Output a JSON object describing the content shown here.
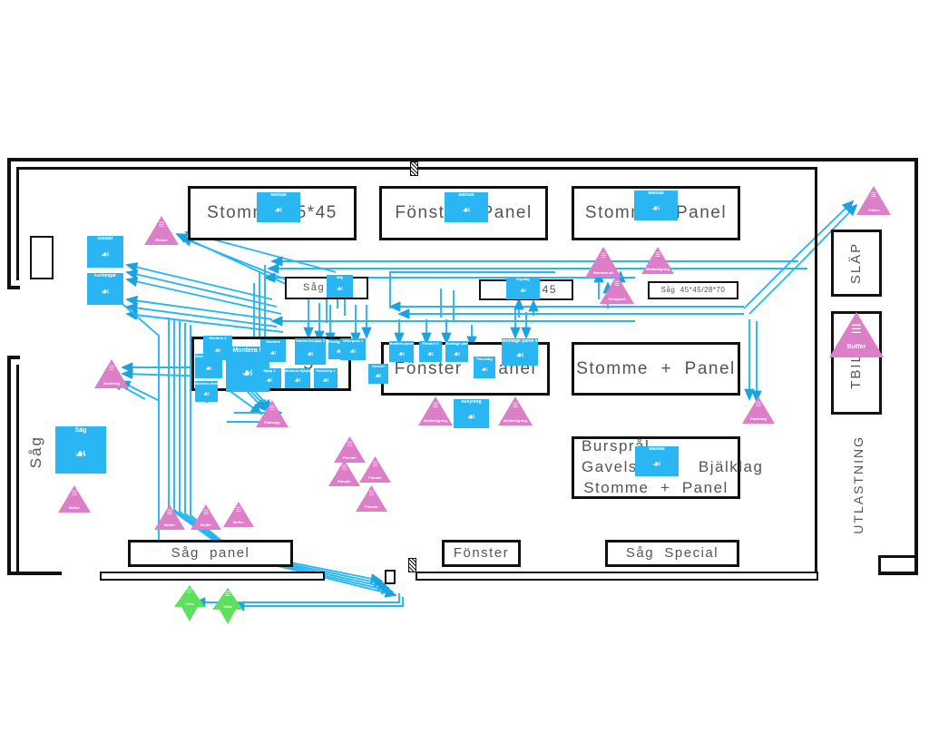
{
  "diagram": {
    "title": "Factory layout value stream map",
    "colors": {
      "process_fill": "#29b6f2",
      "inventory_fill": "#dd7ec8",
      "material_fill": "#5de05d",
      "flow_line": "#29b6f2",
      "wall": "#111111",
      "label_text": "#555555"
    }
  },
  "areas": [
    {
      "name": "stomme-45x45-area",
      "label": "Stomme 45*45"
    },
    {
      "name": "fonster-panel-area",
      "label": "Fönster   Panel"
    },
    {
      "name": "stomme-panel-area",
      "label": "Stomme   Panel"
    },
    {
      "name": "sag-cell-area",
      "label": "Såg"
    },
    {
      "name": "sag-45-area",
      "label": "45"
    },
    {
      "name": "sag-dim-area",
      "label": "Såg  45*45/28*70"
    },
    {
      "name": "montera-area",
      "label": "4          5"
    },
    {
      "name": "fonster-panel-cell",
      "label": "Fönster  +  anel"
    },
    {
      "name": "stomme-panel-cell",
      "label": "Stomme  +  Panel"
    },
    {
      "name": "bjalklag-area",
      "line1": "Bursprål",
      "line2": "Gavelsp         Bjälklag",
      "line3": "Stomme  +  Panel"
    },
    {
      "name": "sag-panel-area",
      "label": "Såg  panel"
    },
    {
      "name": "fonster-area",
      "label": "Fönster"
    },
    {
      "name": "sag-special-area",
      "label": "Såg  Special"
    },
    {
      "name": "slap-area",
      "label": "SLÄP"
    },
    {
      "name": "tbil-area",
      "label": "TBIL"
    },
    {
      "name": "utlastning-label",
      "label": "UTLASTNING"
    },
    {
      "name": "sag-hall-label",
      "label": "Såg"
    }
  ],
  "operations": [
    {
      "name": "op-manual-stomme45",
      "label": "Manual",
      "icon": "worker-icon"
    },
    {
      "name": "op-manual-fonster",
      "label": "Manual",
      "icon": "worker-icon"
    },
    {
      "name": "op-manual-stommepanel",
      "label": "Manual",
      "icon": "worker-icon"
    },
    {
      "name": "op-manual-bjalklag",
      "label": "Manual",
      "icon": "worker-icon"
    },
    {
      "name": "op-stolpar",
      "label": "Stolpar",
      "icon": "worker-icon"
    },
    {
      "name": "op-kortlingar",
      "label": "Kortlingar",
      "icon": "worker-icon"
    },
    {
      "name": "op-sag",
      "label": "Såg",
      "icon": "worker-icon"
    },
    {
      "name": "op-kapsag",
      "label": "Kapsåg",
      "icon": "worker-icon"
    },
    {
      "name": "op-montera-1",
      "label": "Montera stom 1",
      "icon": "worker-icon"
    },
    {
      "name": "op-montera-2",
      "label": "Montera stom 2",
      "icon": "worker-icon"
    },
    {
      "name": "op-montera-3",
      "label": "Montera 3",
      "icon": "worker-icon"
    },
    {
      "name": "op-montera-5",
      "label": "Montera 5",
      "icon": "worker-icon"
    },
    {
      "name": "op-montera-4",
      "label": "Montera",
      "icon": "worker-icon"
    },
    {
      "name": "op-hantverkshjalp",
      "label": "Hantverkshjälp 3",
      "icon": "worker-icon"
    },
    {
      "name": "op-fardigmontering",
      "label": "Färdigmontering",
      "icon": "worker-icon"
    },
    {
      "name": "op-hjalp-2",
      "label": "Hjälp 2",
      "icon": "worker-icon"
    },
    {
      "name": "op-montera-hjalp-5",
      "label": "Montera hjälpa 5",
      "icon": "worker-icon"
    },
    {
      "name": "op-packning-1",
      "label": "Packning 1",
      "icon": "worker-icon"
    },
    {
      "name": "op-vaterpack-1",
      "label": "Väterpack 1",
      "icon": "worker-icon"
    },
    {
      "name": "op-vanster",
      "label": "Vänster",
      "icon": "worker-icon"
    },
    {
      "name": "op-montera-panel-1",
      "label": "Montera panel",
      "icon": "worker-icon"
    },
    {
      "name": "op-fonster-1",
      "label": "Fönster 1",
      "icon": "worker-icon"
    },
    {
      "name": "op-montage-1",
      "label": "Montage panel 1",
      "icon": "worker-icon"
    },
    {
      "name": "op-montage-panel-4",
      "label": "Montage panel 4",
      "icon": "worker-icon"
    },
    {
      "name": "op-panelsag",
      "label": "Panelsåg",
      "icon": "worker-icon"
    },
    {
      "name": "op-avsyning",
      "label": "Avsyning",
      "icon": "worker-icon"
    },
    {
      "name": "op-sag-hall",
      "label": "Såg",
      "icon": "worker-icon"
    }
  ],
  "inventories": [
    {
      "name": "tri-riktare",
      "label": "Riktare",
      "icon": "inventory-icon"
    },
    {
      "name": "tri-sortering",
      "label": "Sortering",
      "icon": "inventory-icon"
    },
    {
      "name": "tri-flakkapp",
      "label": "Flakkapp",
      "icon": "inventory-icon"
    },
    {
      "name": "tri-buffer-left",
      "label": "Buffer",
      "icon": "inventory-icon"
    },
    {
      "name": "tri-mellanlagring-1",
      "label": "Mellanlagring",
      "icon": "inventory-icon"
    },
    {
      "name": "tri-mellanlagring-2",
      "label": "Mellanlagring",
      "icon": "inventory-icon"
    },
    {
      "name": "tri-gleopanel",
      "label": "Gleopanel",
      "icon": "inventory-icon"
    },
    {
      "name": "tri-montera-stt",
      "label": "Montera stt",
      "icon": "inventory-icon"
    },
    {
      "name": "tri-mellanlagring-3",
      "label": "Mellanlagring",
      "icon": "inventory-icon"
    },
    {
      "name": "tri-fonster-1",
      "label": "Fönster",
      "icon": "inventory-icon"
    },
    {
      "name": "tri-fonster-2",
      "label": "Fönster",
      "icon": "inventory-icon"
    },
    {
      "name": "tri-fonster-3",
      "label": "Fönster",
      "icon": "inventory-icon"
    },
    {
      "name": "tri-fonster-4",
      "label": "Fönster",
      "icon": "inventory-icon"
    },
    {
      "name": "tri-buffer-b1",
      "label": "Buffer",
      "icon": "inventory-icon"
    },
    {
      "name": "tri-buffer-b2",
      "label": "Buffer",
      "icon": "inventory-icon"
    },
    {
      "name": "tri-buffer-b3",
      "label": "Buffer",
      "icon": "inventory-icon"
    },
    {
      "name": "tri-buffer-tbil",
      "label": "Buffer",
      "icon": "inventory-icon"
    },
    {
      "name": "tri-vidare",
      "label": "Vidare",
      "icon": "inventory-icon"
    },
    {
      "name": "tri-packning-r",
      "label": "Packning",
      "icon": "inventory-icon"
    },
    {
      "name": "tri-virke-1",
      "label": "Virke",
      "icon": "material-icon"
    },
    {
      "name": "tri-virke-2",
      "label": "Virke",
      "icon": "material-icon"
    }
  ]
}
